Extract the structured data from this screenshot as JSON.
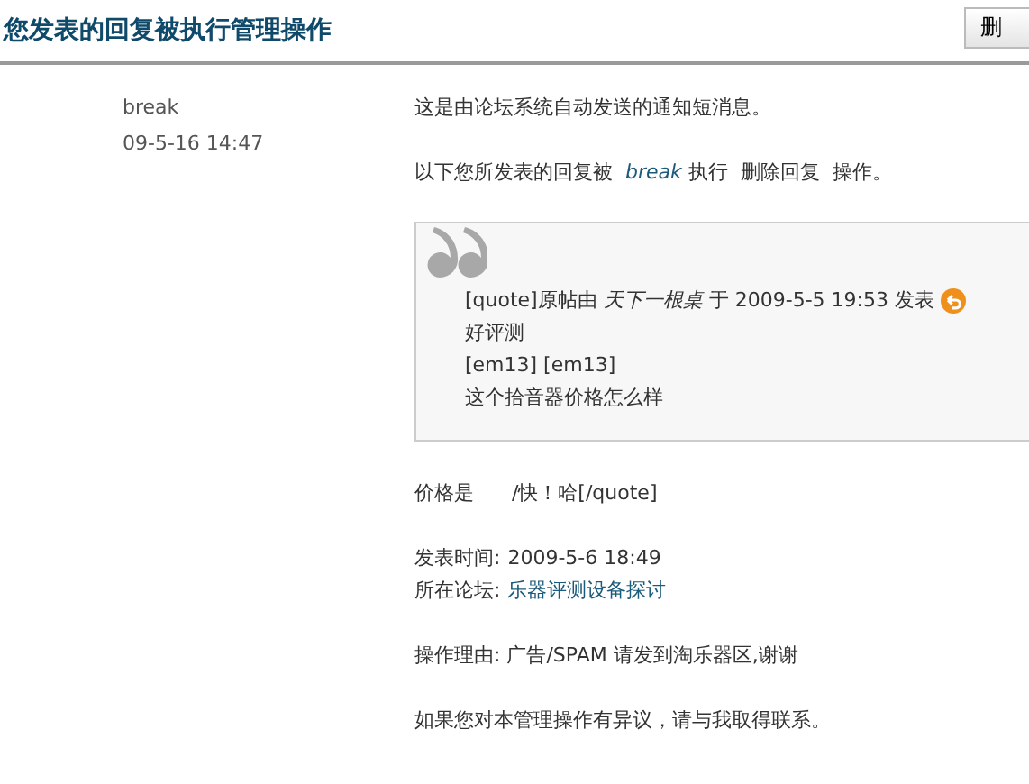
{
  "header": {
    "title": "您发表的回复被执行管理操作",
    "button": "删"
  },
  "sender": {
    "name": "break",
    "time": "09-5-16 14:47"
  },
  "intro": "这是由论坛系统自动发送的通知短消息。",
  "action_line": {
    "before": "以下您所发表的回复被",
    "moderator": "break",
    "middle": "执行",
    "action": "删除回复",
    "after": "操作。"
  },
  "quote": {
    "lines": [
      {
        "kind": "meta",
        "prefix": "[quote]原帖由",
        "author": "天下一根桌",
        "on": "于",
        "time": "2009-5-5 19:53 发表"
      },
      {
        "kind": "text",
        "text": "好评测"
      },
      {
        "kind": "text",
        "text": "[em13] [em13]"
      },
      {
        "kind": "text",
        "text": "这个拾音器价格怎么样"
      }
    ]
  },
  "after_quote": "价格是      /快！哈[/quote]",
  "details": [
    {
      "label": "发表时间:",
      "value": "2009-5-6 18:49",
      "link": false
    },
    {
      "label": "所在论坛:",
      "value": "乐器评测设备探讨",
      "link": true
    }
  ],
  "reason": {
    "label": "操作理由:",
    "value": "广告/SPAM 请发到淘乐器区,谢谢"
  },
  "footer": "如果您对本管理操作有异议，请与我取得联系。"
}
